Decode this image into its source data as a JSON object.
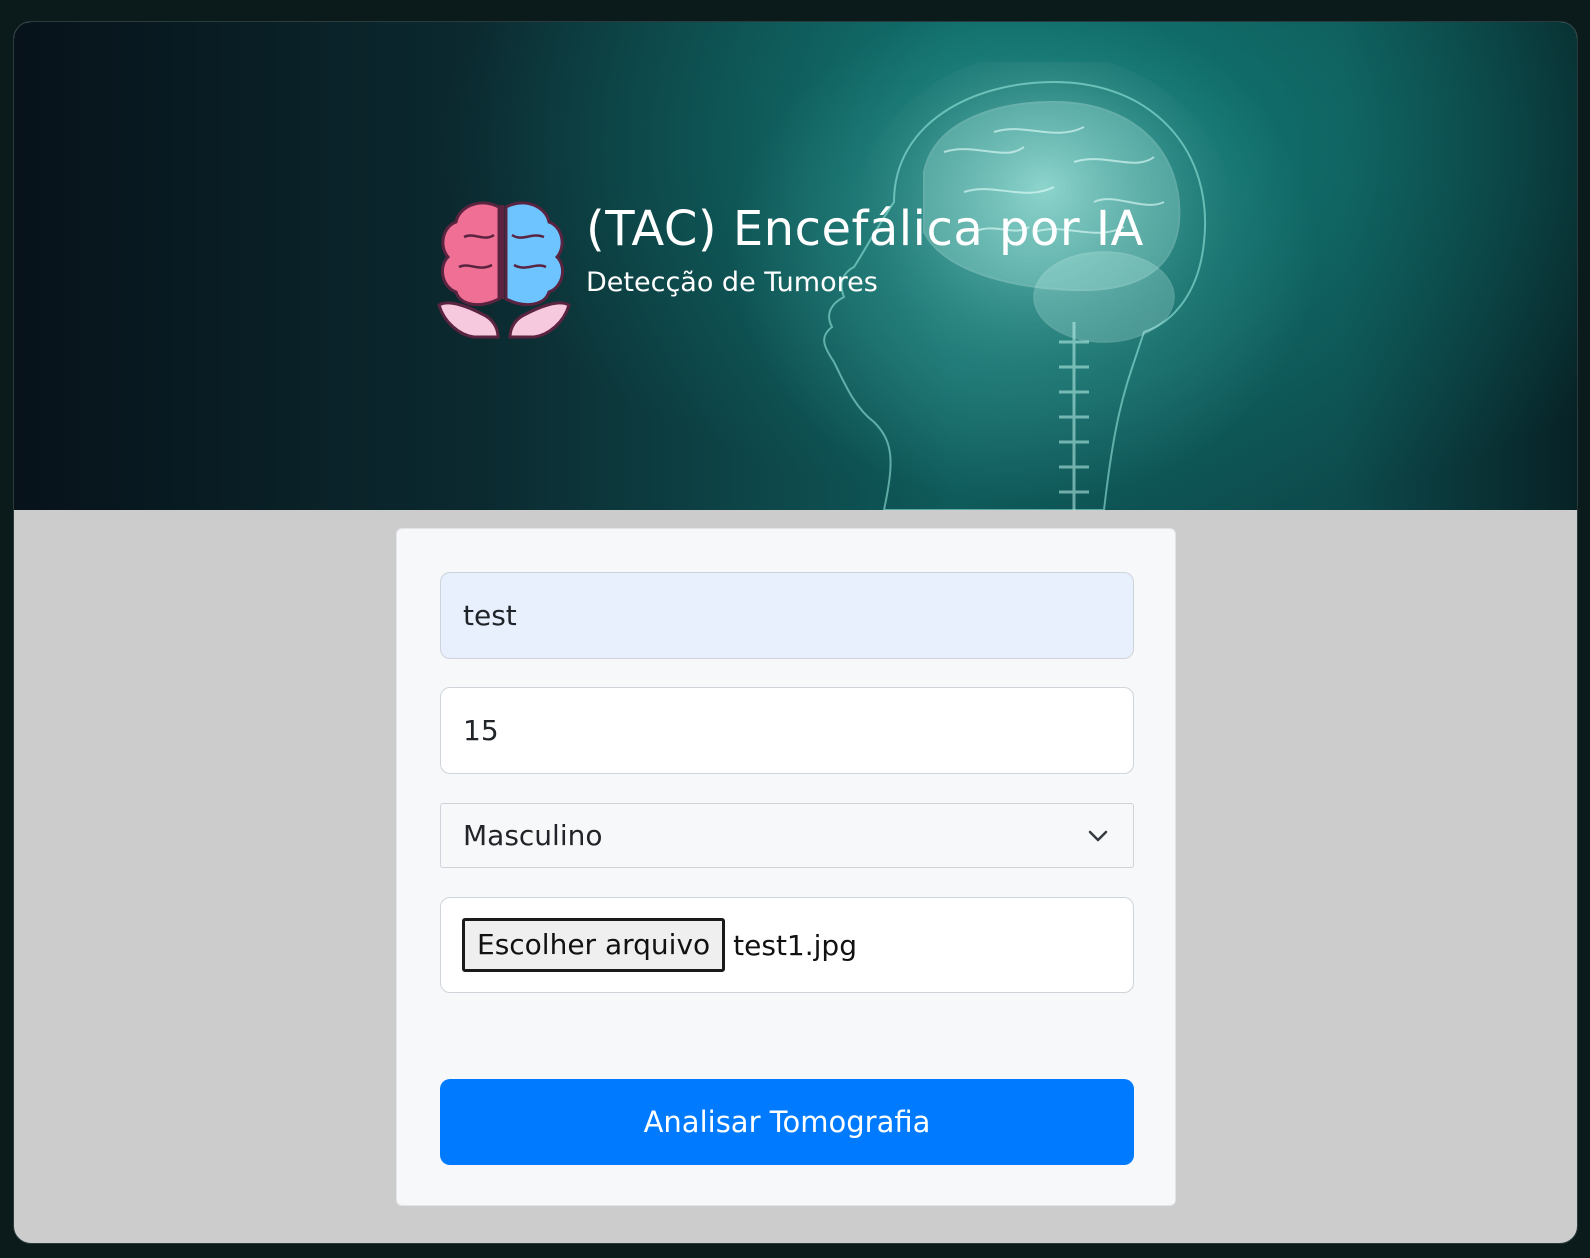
{
  "header": {
    "title": "(TAC) Encefálica por IA",
    "subtitle": "Detecção de Tumores",
    "logo_icon": "brain-in-hands-icon"
  },
  "form": {
    "name_value": "test",
    "age_value": "15",
    "sex_selected": "Masculino",
    "file_button_label": "Escolher arquivo",
    "file_name": "test1.jpg",
    "submit_label": "Analisar Tomografia"
  },
  "colors": {
    "primary_button": "#007bff",
    "autofill_field": "#e8f0fe",
    "page_background": "#cccccc"
  }
}
